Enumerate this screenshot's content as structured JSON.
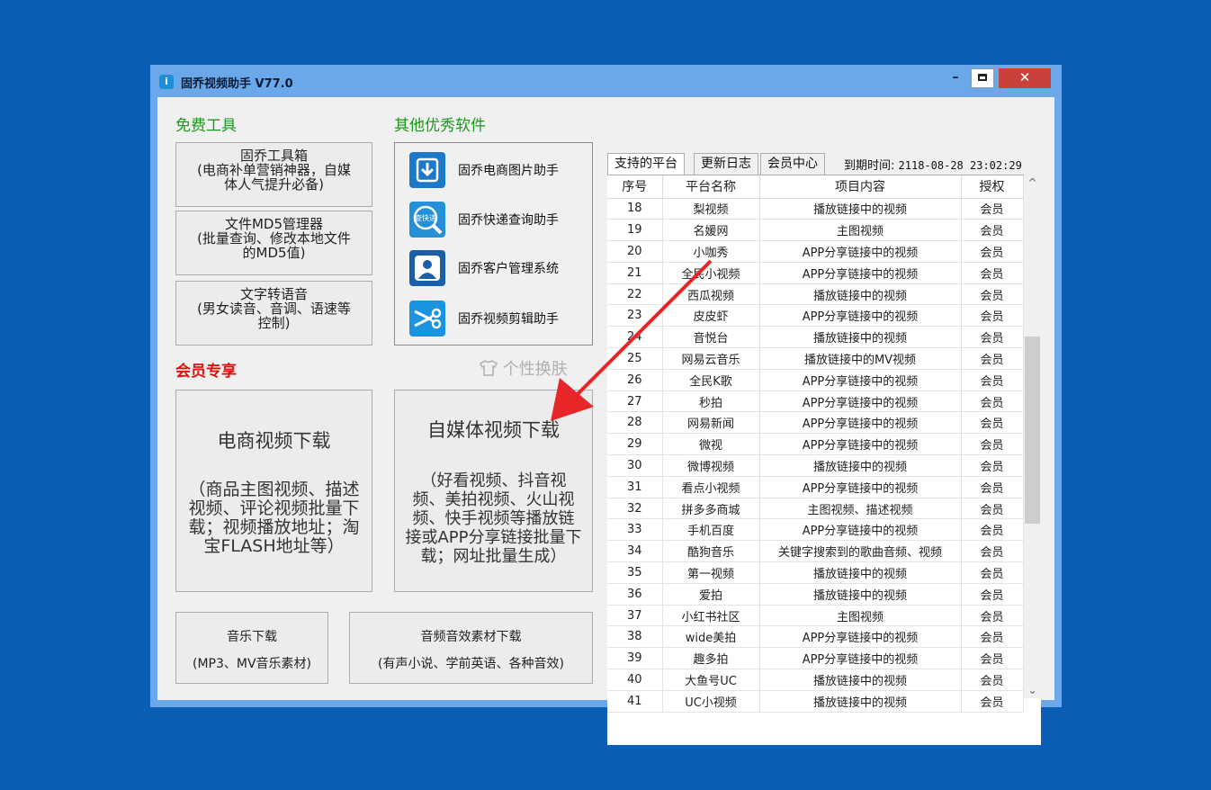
{
  "window": {
    "title": "固乔视频助手 V77.0",
    "icon": "app-icon",
    "icon_glyph": "i"
  },
  "controls": {
    "minimize": "–",
    "close": "✕"
  },
  "free_tools": {
    "heading": "免费工具",
    "buttons": [
      {
        "lines": [
          "固乔工具箱",
          "(电商补单营销神器，自媒",
          "体人气提升必备)"
        ]
      },
      {
        "lines": [
          "文件MD5管理器",
          "(批量查询、修改本地文件",
          "的MD5值)"
        ]
      },
      {
        "lines": [
          "文字转语音",
          "(男女读音、音调、语速等",
          "控制)"
        ]
      }
    ]
  },
  "other_software": {
    "heading": "其他优秀软件",
    "items": [
      {
        "label": "固乔电商图片助手",
        "icon": "download-icon",
        "glyph": "⬇",
        "color": "#1c78c8"
      },
      {
        "label": "固乔快递查询助手",
        "icon": "express-search-icon",
        "glyph": "查快递",
        "color": "#2490d8"
      },
      {
        "label": "固乔客户管理系统",
        "icon": "customer-icon",
        "glyph": "👤",
        "color": "#1b5fa8"
      },
      {
        "label": "固乔视频剪辑助手",
        "icon": "scissors-icon",
        "glyph": "✂",
        "color": "#1a93e0"
      }
    ]
  },
  "member": {
    "heading": "会员专享",
    "skin_label": "个性换肤",
    "skin_icon": "shirt-icon",
    "ecommerce": {
      "title": "电商视频下载",
      "desc": [
        "（商品主图视频、描述",
        "视频、评论视频批量下",
        "载；视频播放地址；淘",
        "宝FLASH地址等）"
      ]
    },
    "media": {
      "title": "自媒体视频下载",
      "desc": [
        "（好看视频、抖音视",
        "频、美拍视频、火山视",
        "频、快手视频等播放链",
        "接或APP分享链接批量下",
        "载；网址批量生成）"
      ]
    }
  },
  "bottom_buttons": [
    {
      "title": "音乐下载",
      "subtitle": "(MP3、MV音乐素材)"
    },
    {
      "title": "音频音效素材下载",
      "subtitle": "(有声小说、学前英语、各种音效)"
    }
  ],
  "tabs": [
    "支持的平台",
    "更新日志",
    "会员中心"
  ],
  "expire": {
    "label": "到期时间:",
    "value": "2118-08-28 23:02:29"
  },
  "table": {
    "columns": [
      "序号",
      "平台名称",
      "项目内容",
      "授权"
    ],
    "rows": [
      [
        "18",
        "梨视频",
        "播放链接中的视频",
        "会员"
      ],
      [
        "19",
        "名媛网",
        "主图视频",
        "会员"
      ],
      [
        "20",
        "小咖秀",
        "APP分享链接中的视频",
        "会员"
      ],
      [
        "21",
        "全民小视频",
        "APP分享链接中的视频",
        "会员"
      ],
      [
        "22",
        "西瓜视频",
        "播放链接中的视频",
        "会员"
      ],
      [
        "23",
        "皮皮虾",
        "APP分享链接中的视频",
        "会员"
      ],
      [
        "24",
        "音悦台",
        "播放链接中的视频",
        "会员"
      ],
      [
        "25",
        "网易云音乐",
        "播放链接中的MV视频",
        "会员"
      ],
      [
        "26",
        "全民K歌",
        "APP分享链接中的视频",
        "会员"
      ],
      [
        "27",
        "秒拍",
        "APP分享链接中的视频",
        "会员"
      ],
      [
        "28",
        "网易新闻",
        "APP分享链接中的视频",
        "会员"
      ],
      [
        "29",
        "微视",
        "APP分享链接中的视频",
        "会员"
      ],
      [
        "30",
        "微博视频",
        "播放链接中的视频",
        "会员"
      ],
      [
        "31",
        "看点小视频",
        "APP分享链接中的视频",
        "会员"
      ],
      [
        "32",
        "拼多多商城",
        "主图视频、描述视频",
        "会员"
      ],
      [
        "33",
        "手机百度",
        "APP分享链接中的视频",
        "会员"
      ],
      [
        "34",
        "酷狗音乐",
        "关键字搜索到的歌曲音频、视频",
        "会员"
      ],
      [
        "35",
        "第一视频",
        "播放链接中的视频",
        "会员"
      ],
      [
        "36",
        "爱拍",
        "播放链接中的视频",
        "会员"
      ],
      [
        "37",
        "小红书社区",
        "主图视频",
        "会员"
      ],
      [
        "38",
        "wide美拍",
        "APP分享链接中的视频",
        "会员"
      ],
      [
        "39",
        "趣多拍",
        "APP分享链接中的视频",
        "会员"
      ],
      [
        "40",
        "大鱼号UC",
        "播放链接中的视频",
        "会员"
      ],
      [
        "41",
        "UC小视频",
        "播放链接中的视频",
        "会员"
      ]
    ]
  },
  "scrollbar": {
    "up": "^",
    "down": "⌄"
  },
  "colors": {
    "desktop": "#0a5fb4",
    "titlebar": "#6aa8ea",
    "close": "#c9413a",
    "free_heading": "#1a9a1a",
    "member_heading": "#e01010",
    "arrow": "#e8262a"
  }
}
